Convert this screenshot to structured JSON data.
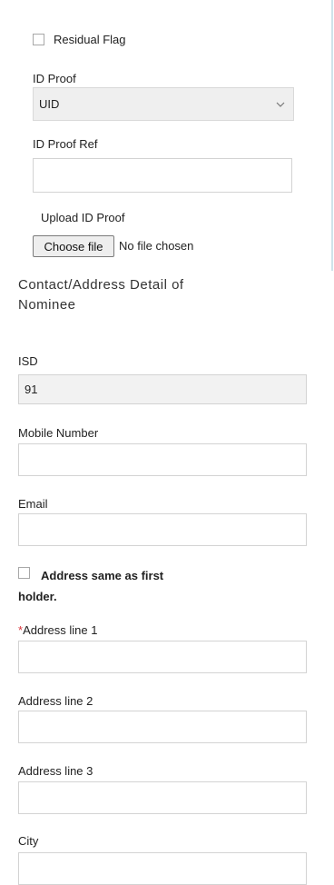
{
  "residual_flag": {
    "label": "Residual Flag",
    "checked": false
  },
  "id_proof": {
    "label": "ID Proof",
    "selected": "UID"
  },
  "id_proof_ref": {
    "label": "ID Proof Ref",
    "value": ""
  },
  "upload": {
    "label": "Upload ID Proof",
    "button_label": "Choose file",
    "status": "No file chosen"
  },
  "section_heading": "Contact/Address Detail of Nominee",
  "isd": {
    "label": "ISD",
    "value": "91"
  },
  "mobile": {
    "label": "Mobile Number",
    "value": ""
  },
  "email": {
    "label": "Email",
    "value": ""
  },
  "address_same": {
    "label": "Address same as first holder.",
    "checked": false
  },
  "address1": {
    "required_mark": "*",
    "label": "Address line 1",
    "value": ""
  },
  "address2": {
    "label": "Address line 2",
    "value": ""
  },
  "address3": {
    "label": "Address line 3",
    "value": ""
  },
  "city": {
    "label": "City",
    "value": ""
  }
}
